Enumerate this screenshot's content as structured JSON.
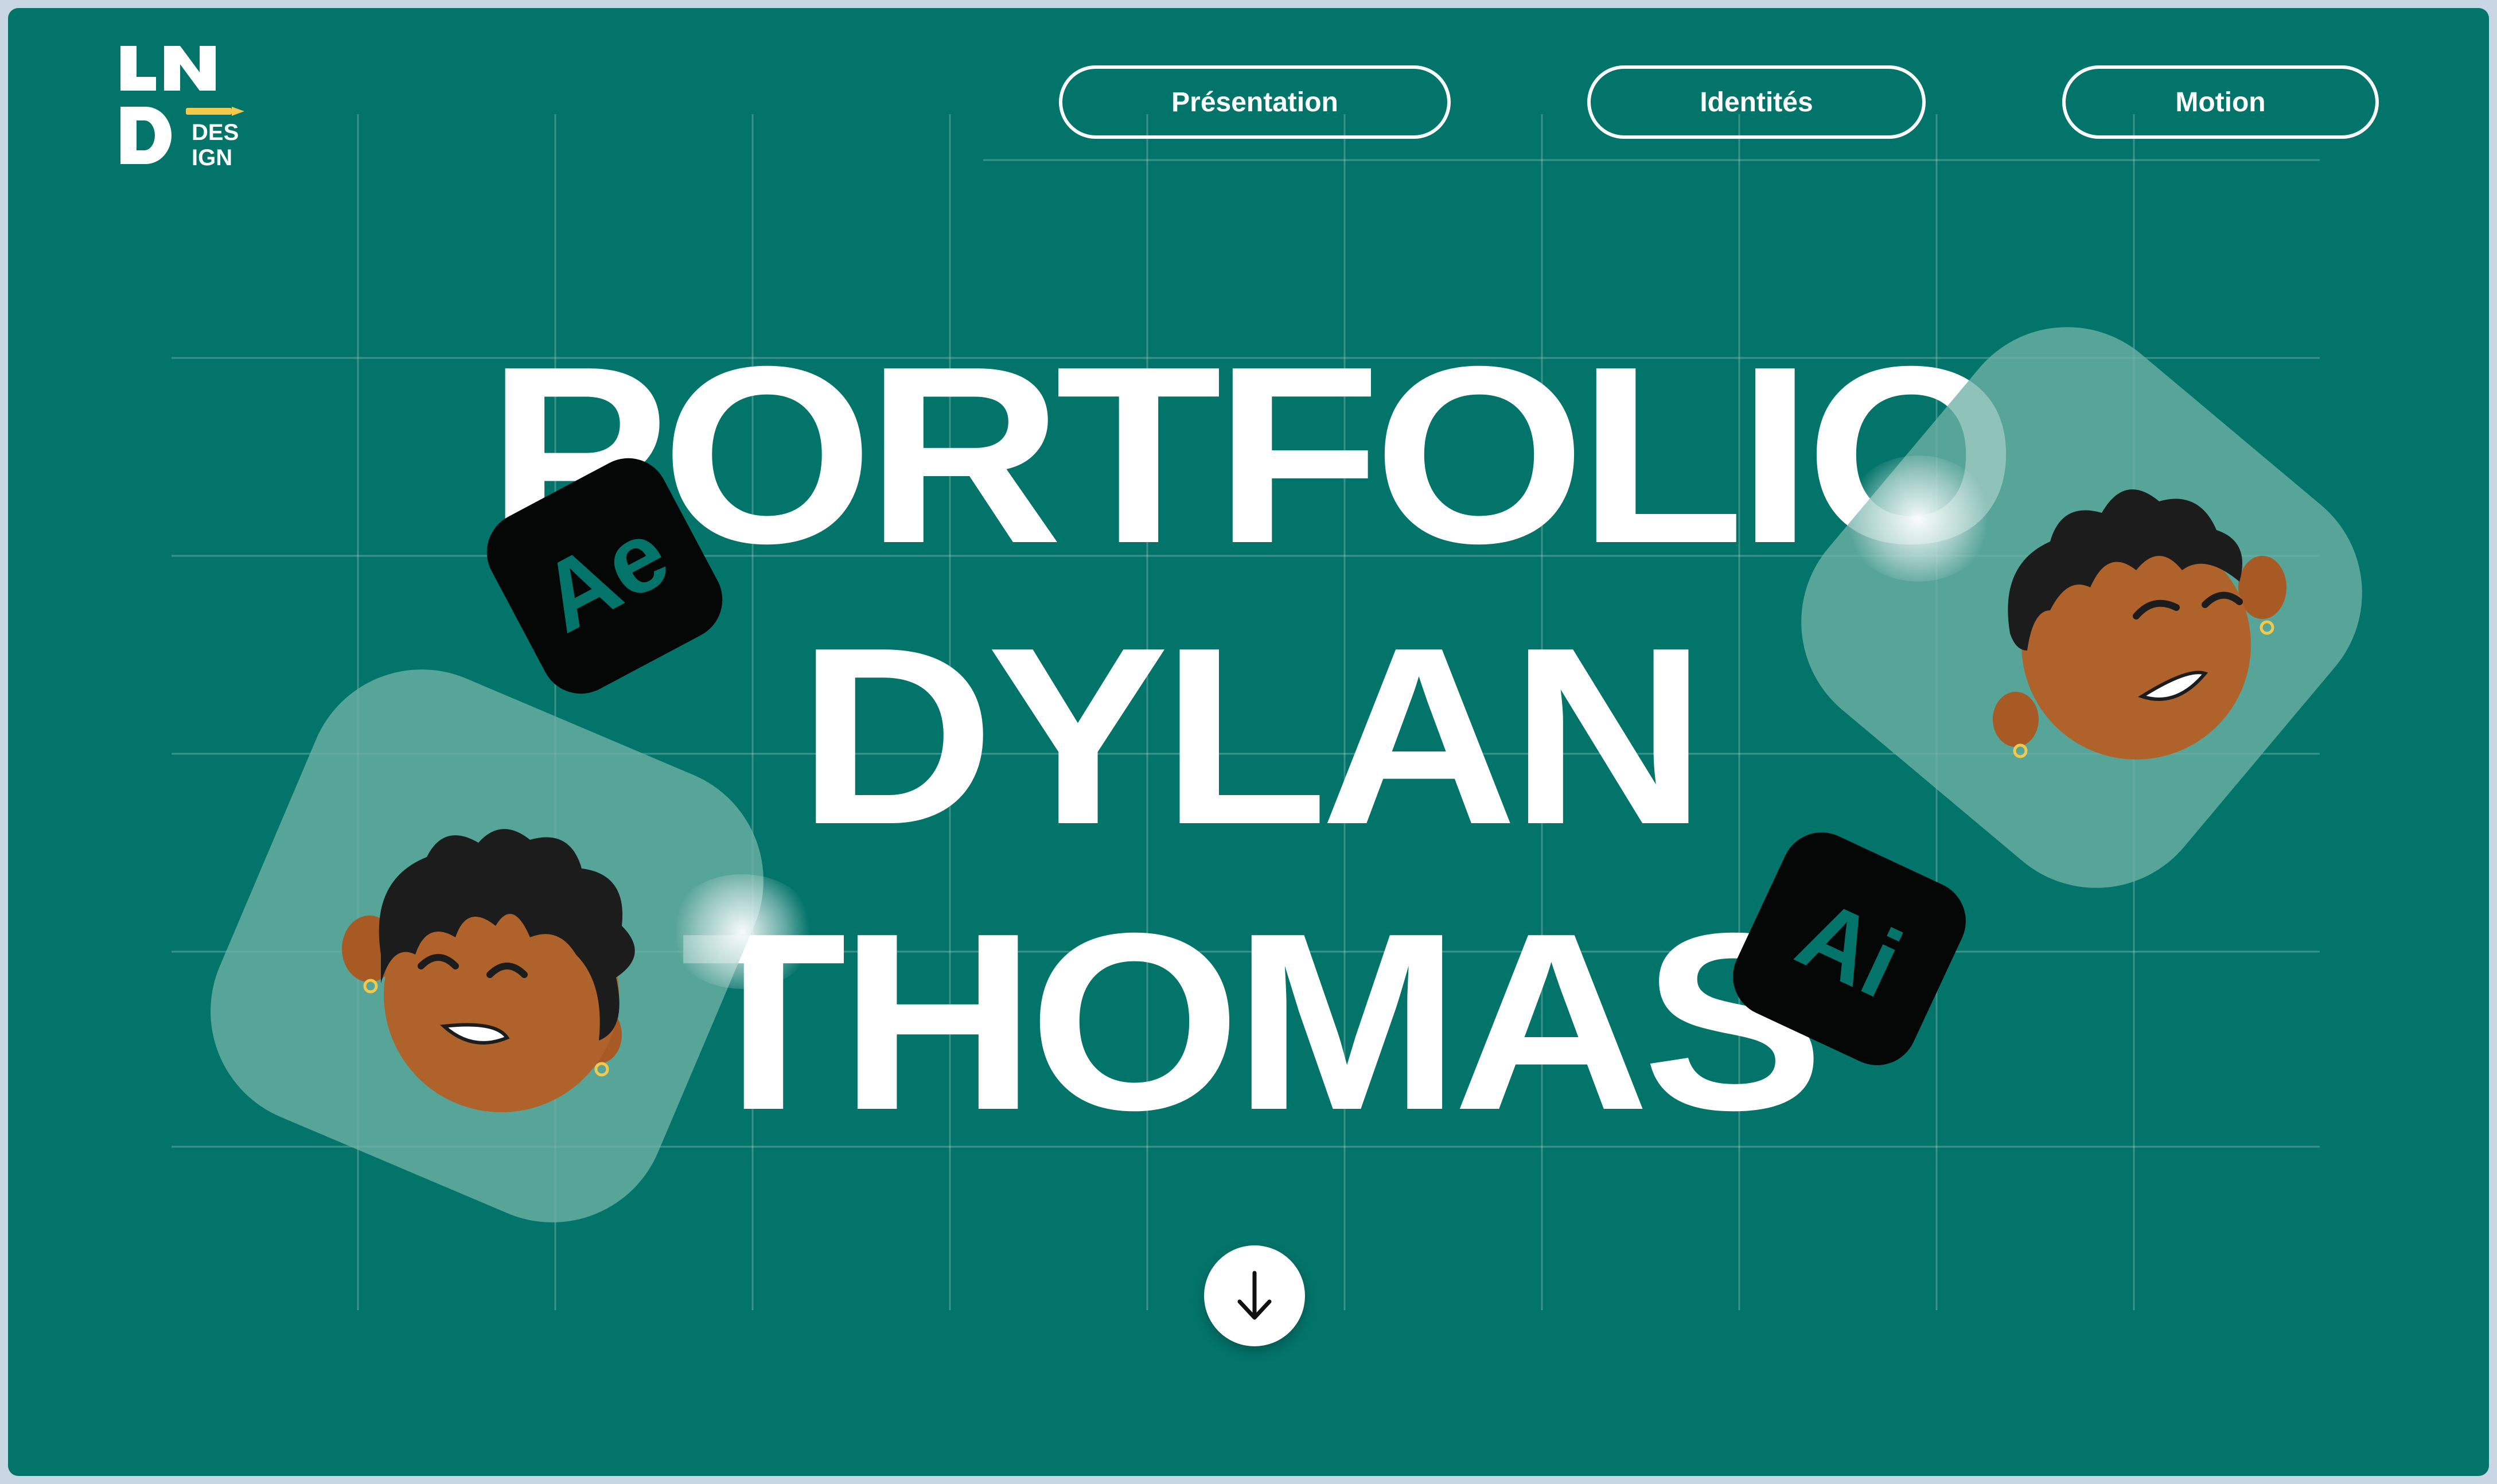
{
  "logo": {
    "line1": "LN",
    "line2": "D",
    "des": "DES",
    "ign": "IGN",
    "accent_color": "#f2c94c"
  },
  "nav": {
    "items": [
      {
        "label": "Présentation"
      },
      {
        "label": "Identités"
      },
      {
        "label": "Motion"
      }
    ]
  },
  "hero": {
    "line1": "PORTFOLIO",
    "line2": "DYLAN",
    "line3": "THOMAS"
  },
  "badges": {
    "ae": "Ae",
    "ai": "Ai"
  },
  "scroll": {
    "icon": "arrow-down-icon"
  },
  "colors": {
    "background": "#03746a",
    "text": "#ffffff",
    "tile": "#70b2a6",
    "badge": "#050707",
    "skin": "#b0622b",
    "hair": "#1c1c1c"
  }
}
